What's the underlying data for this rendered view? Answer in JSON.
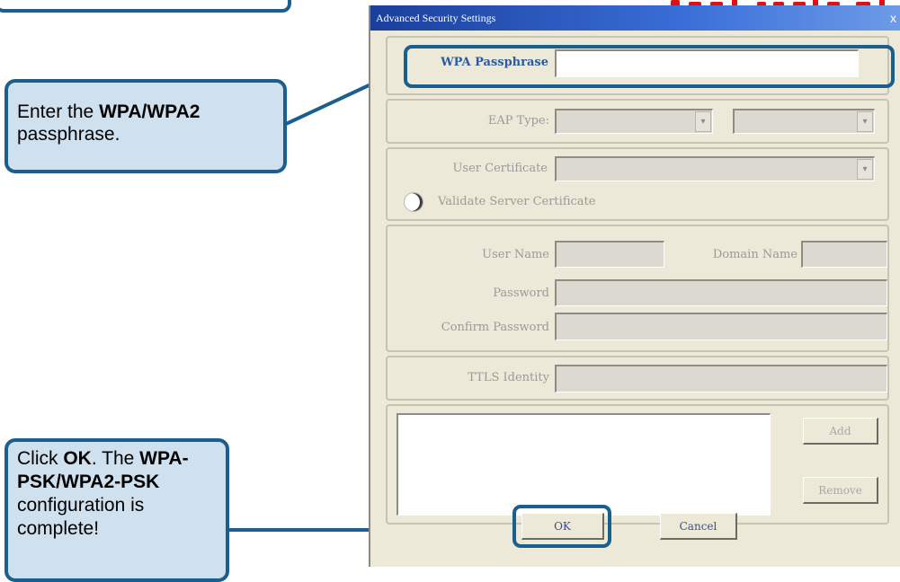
{
  "dialog": {
    "title": "Advanced Security Settings",
    "close_glyph": "x",
    "wpa_passphrase_label": "WPA Passphrase",
    "wpa_passphrase_value": "",
    "eap_type_label": "EAP Type:",
    "user_certificate_label": "User Certificate",
    "validate_server_label": "Validate Server Certificate",
    "user_name_label": "User Name",
    "domain_name_label": "Domain Name",
    "password_label": "Password",
    "confirm_password_label": "Confirm Password",
    "ttls_identity_label": "TTLS Identity",
    "add_label": "Add",
    "remove_label": "Remove",
    "ok_label": "OK",
    "cancel_label": "Cancel",
    "combo_arrow_glyph": "▾"
  },
  "callouts": {
    "passphrase_pre": "Enter the ",
    "passphrase_bold": "WPA/WPA2",
    "passphrase_post": "passphrase.",
    "ok_pre": "Click ",
    "ok_bold1": "OK",
    "ok_mid": ". The ",
    "ok_bold2": "WPA-PSK/WPA2-PSK",
    "ok_post": "configuration is complete!"
  },
  "colors": {
    "callout_border": "#1b5f8e",
    "callout_fill": "#cfe0ee",
    "title_gradient_start": "#1a3f9c",
    "label_highlight": "#2b5aa0",
    "heading_red": "#e01010"
  }
}
